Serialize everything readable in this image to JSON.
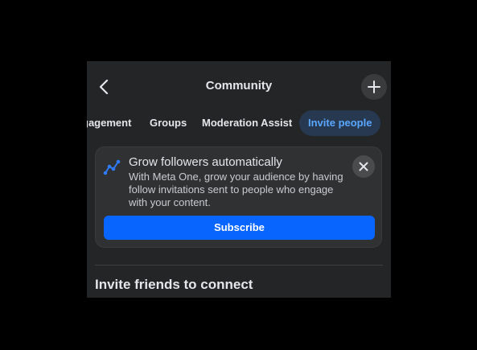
{
  "header": {
    "title": "Community",
    "back_icon": "chevron-left-icon",
    "add_icon": "plus-icon"
  },
  "tabs": [
    {
      "label": "gagement"
    },
    {
      "label": "Groups"
    },
    {
      "label": "Moderation Assist"
    },
    {
      "label": "Invite people",
      "active": true
    }
  ],
  "promo_card": {
    "icon": "trend-line-icon",
    "title": "Grow followers automatically",
    "body": "With Meta One, grow your audience by having follow invitations sent to people who engage with your content.",
    "close_icon": "close-icon",
    "button_label": "Subscribe"
  },
  "section": {
    "title": "Invite friends to connect"
  },
  "colors": {
    "background": "#242526",
    "accent": "#0866ff",
    "active_tab_bg": "#263951",
    "active_tab_text": "#5aa7ff"
  }
}
